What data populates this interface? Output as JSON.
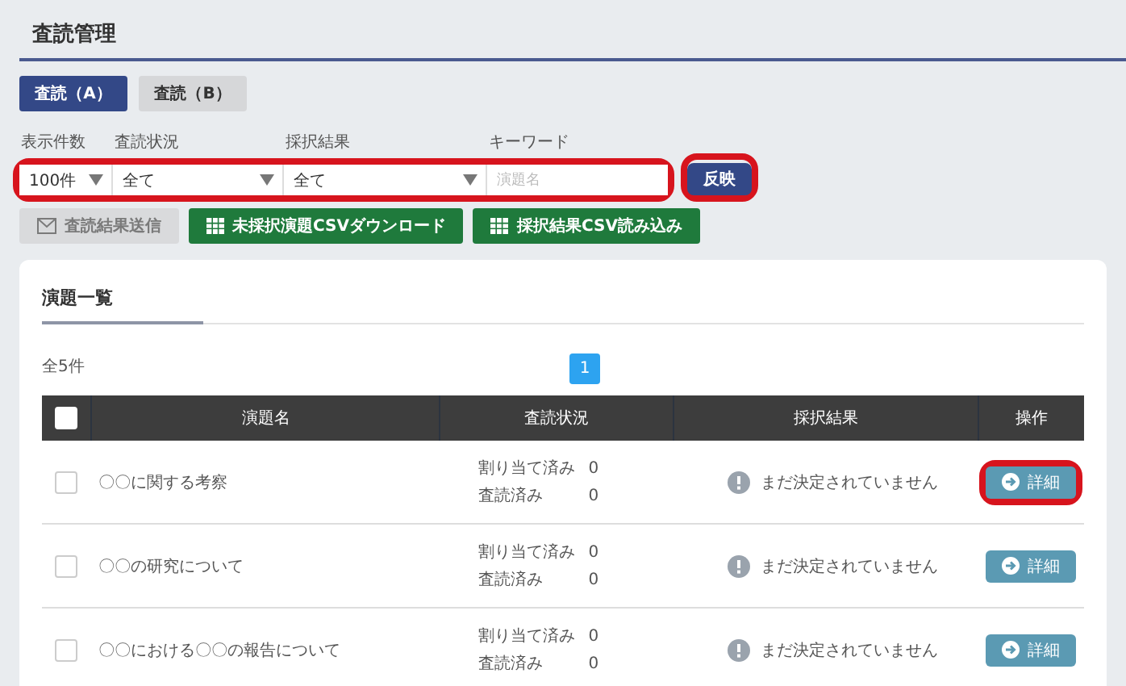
{
  "page_title": "査読管理",
  "tabs": [
    {
      "label": "査読（A）",
      "selected": true
    },
    {
      "label": "査読（B）",
      "selected": false
    }
  ],
  "filters": {
    "highlight": true,
    "fields": [
      {
        "label": "表示件数",
        "kind": "select",
        "value": "100件"
      },
      {
        "label": "査読状況",
        "kind": "select",
        "value": "全て"
      },
      {
        "label": "採択結果",
        "kind": "select",
        "value": "全て"
      },
      {
        "label": "キーワード",
        "kind": "text",
        "placeholder": "演題名"
      }
    ]
  },
  "apply_button": {
    "label": "反映",
    "highlight": true
  },
  "actions": [
    {
      "label": "査読結果送信",
      "kind": "mail",
      "disabled": true
    },
    {
      "label": "未採択演題CSVダウンロード",
      "kind": "csv",
      "disabled": false
    },
    {
      "label": "採択結果CSV読み込み",
      "kind": "csv",
      "disabled": false
    }
  ],
  "list": {
    "title": "演題一覧",
    "count": "全5件",
    "pages": [
      {
        "label": "1",
        "selected": true
      }
    ],
    "header_checked": false,
    "columns": [
      "演題名",
      "査読状況",
      "採択結果",
      "操作"
    ],
    "rows": [
      {
        "checked": false,
        "title": "〇〇に関する考察",
        "assigned_label": "割り当て済み",
        "assigned": "0",
        "reviewed_label": "査読済み",
        "reviewed": "0",
        "result": "まだ決定されていません",
        "button": "詳細",
        "highlight": true
      },
      {
        "checked": false,
        "title": "〇〇の研究について",
        "assigned_label": "割り当て済み",
        "assigned": "0",
        "reviewed_label": "査読済み",
        "reviewed": "0",
        "result": "まだ決定されていません",
        "button": "詳細",
        "highlight": false
      },
      {
        "checked": false,
        "title": "〇〇における〇〇の報告について",
        "assigned_label": "割り当て済み",
        "assigned": "0",
        "reviewed_label": "査読済み",
        "reviewed": "0",
        "result": "まだ決定されていません",
        "button": "詳細",
        "highlight": false
      }
    ]
  }
}
